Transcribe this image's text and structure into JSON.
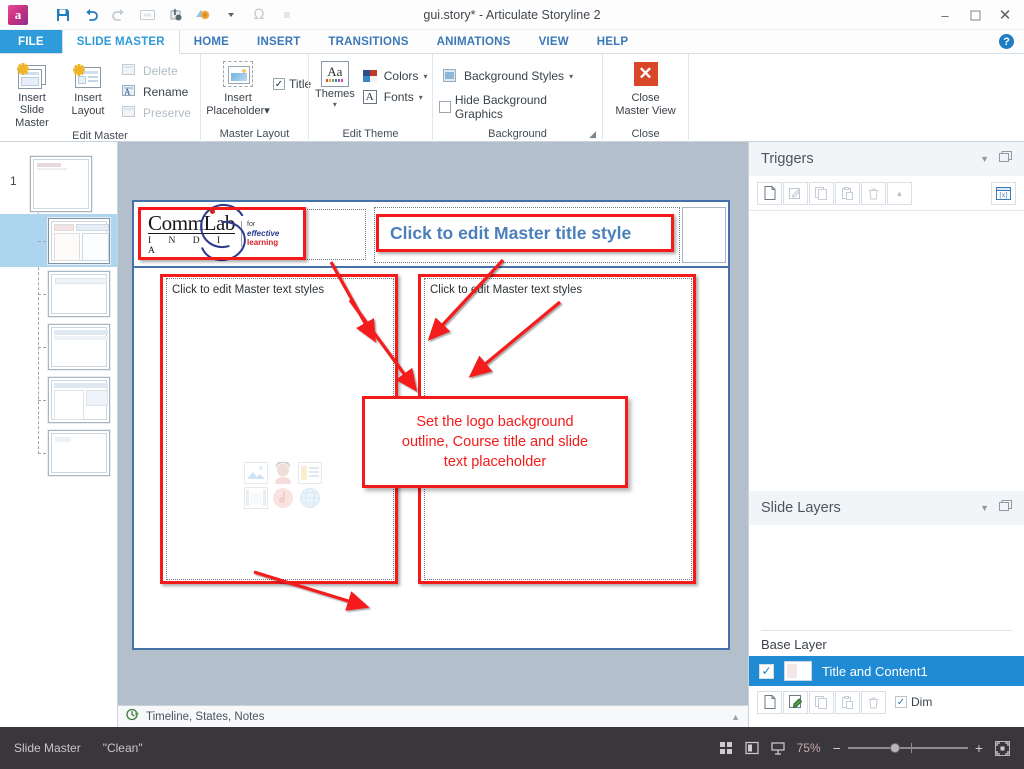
{
  "titlebar": {
    "app_icon": "articulate-logo-icon",
    "document_title": "gui.story*  -  Articulate Storyline 2",
    "quick_access": [
      {
        "name": "save-icon",
        "label": "Save",
        "state": "enabled"
      },
      {
        "name": "undo-icon",
        "label": "Undo",
        "state": "enabled"
      },
      {
        "name": "redo-icon",
        "label": "Redo",
        "state": "disabled"
      },
      {
        "name": "preview-icon",
        "label": "Preview",
        "state": "disabled"
      },
      {
        "name": "publish-icon",
        "label": "Publish",
        "state": "enabled"
      },
      {
        "name": "translation-icon",
        "label": "Translation",
        "state": "enabled"
      },
      {
        "name": "symbol-omega-icon",
        "label": "Symbol",
        "state": "disabled"
      },
      {
        "name": "customize-qat-icon",
        "label": "Customize Quick Access Toolbar",
        "state": "enabled"
      }
    ],
    "window_controls": [
      {
        "name": "minimize-button",
        "glyph": "–"
      },
      {
        "name": "maximize-button",
        "glyph": "❐"
      },
      {
        "name": "close-button",
        "glyph": "✕"
      }
    ]
  },
  "ribbon": {
    "tabs": [
      {
        "label": "FILE",
        "key": "file"
      },
      {
        "label": "SLIDE MASTER",
        "key": "slide-master",
        "active": true
      },
      {
        "label": "HOME",
        "key": "home"
      },
      {
        "label": "INSERT",
        "key": "insert"
      },
      {
        "label": "TRANSITIONS",
        "key": "transitions"
      },
      {
        "label": "ANIMATIONS",
        "key": "animations"
      },
      {
        "label": "VIEW",
        "key": "view"
      },
      {
        "label": "HELP",
        "key": "help"
      }
    ],
    "help_icon": "?",
    "groups": {
      "edit_master": {
        "label": "Edit Master",
        "insert_slide_master": "Insert Slide\nMaster",
        "insert_slide_master_l1": "Insert Slide",
        "insert_slide_master_l2": "Master",
        "insert_layout_l1": "Insert",
        "insert_layout_l2": "Layout",
        "delete": "Delete",
        "rename": "Rename",
        "preserve": "Preserve"
      },
      "master_layout": {
        "label": "Master Layout",
        "insert_placeholder_l1": "Insert",
        "insert_placeholder_l2": "Placeholder",
        "title_checkbox": "Title",
        "title_checked": true
      },
      "edit_theme": {
        "label": "Edit Theme",
        "themes": "Themes",
        "colors": "Colors",
        "fonts": "Fonts"
      },
      "background": {
        "label": "Background",
        "background_styles": "Background Styles",
        "hide_background_graphics": "Hide Background Graphics",
        "hide_background_graphics_checked": false
      },
      "close": {
        "label": "Close",
        "close_master_view_l1": "Close",
        "close_master_view_l2": "Master View"
      }
    }
  },
  "thumbnails": {
    "slide_number": "1",
    "items": [
      {
        "name": "thumb-master",
        "selected": false
      },
      {
        "name": "thumb-title-and-content1",
        "selected": true
      },
      {
        "name": "thumb-layout-3",
        "selected": false
      },
      {
        "name": "thumb-layout-4",
        "selected": false
      },
      {
        "name": "thumb-layout-5",
        "selected": false
      },
      {
        "name": "thumb-layout-6",
        "selected": false
      }
    ]
  },
  "slide": {
    "logo": {
      "word_top": "CommLab",
      "word_bottom": "I N D I A",
      "tag_line1": "for",
      "tag_line2_italic": "effective",
      "tag_line2_bold": " learning"
    },
    "title_placeholder": "Click to edit Master title style",
    "body_placeholder_left": "Click to edit Master text styles",
    "body_placeholder_right": "Click to edit Master text styles",
    "callout": {
      "line1": "Set the logo background",
      "line2": "outline, Course title and slide",
      "line3": "text placeholder"
    },
    "content_icons": [
      "picture-icon",
      "character-icon",
      "table-icon",
      "video-icon",
      "audio-icon",
      "web-object-icon"
    ]
  },
  "timeline_strip": {
    "icon": "timeline-icon",
    "label": "Timeline, States, Notes",
    "expand_icon": "chevron-up-icon"
  },
  "triggers_panel": {
    "title": "Triggers",
    "collapse_icon": "chevron-down-icon",
    "undock_icon": "undock-icon",
    "toolbar": [
      {
        "name": "new-trigger-button",
        "icon": "new-document-icon",
        "state": "enabled"
      },
      {
        "name": "edit-trigger-button",
        "icon": "edit-pencil-icon",
        "state": "disabled"
      },
      {
        "name": "copy-trigger-button",
        "icon": "copy-icon",
        "state": "disabled"
      },
      {
        "name": "paste-trigger-button",
        "icon": "paste-icon",
        "state": "disabled"
      },
      {
        "name": "delete-trigger-button",
        "icon": "trash-icon",
        "state": "disabled"
      },
      {
        "name": "move-up-trigger-button",
        "icon": "chevron-up-icon",
        "state": "disabled"
      },
      {
        "name": "manage-variables-button",
        "icon": "variable-icon",
        "state": "enabled"
      }
    ]
  },
  "slide_layers_panel": {
    "title": "Slide Layers",
    "collapse_icon": "chevron-down-icon",
    "undock_icon": "undock-icon",
    "base_layer_label": "Base Layer",
    "layer": {
      "name": "Title and Content1",
      "visible": true,
      "selected": true
    },
    "toolbar": [
      {
        "name": "new-layer-button",
        "icon": "new-document-icon",
        "state": "enabled"
      },
      {
        "name": "layer-properties-button",
        "icon": "properties-icon",
        "state": "enabled"
      },
      {
        "name": "copy-layer-button",
        "icon": "copy-icon",
        "state": "disabled"
      },
      {
        "name": "paste-layer-button",
        "icon": "paste-icon",
        "state": "disabled"
      },
      {
        "name": "delete-layer-button",
        "icon": "trash-icon",
        "state": "disabled"
      }
    ],
    "dim_label": "Dim",
    "dim_checked": true
  },
  "statusbar": {
    "mode": "Slide Master",
    "theme_name": "\"Clean\"",
    "view_icons": [
      {
        "name": "story-view-icon"
      },
      {
        "name": "slide-view-icon"
      },
      {
        "name": "presenter-view-icon"
      }
    ],
    "zoom_level": "75%",
    "zoom_out": "−",
    "zoom_in": "+",
    "fit_icon": "fit-to-window-icon"
  },
  "colors": {
    "accent_blue": "#2e9bda",
    "tab_text_blue": "#3b78b8",
    "annotation_red": "#f41a1a",
    "title_placeholder_blue": "#4a7fba",
    "selection_blue": "#1e8bd4",
    "thumb_selection": "#aed5ef",
    "statusbar_bg": "#39363c",
    "canvas_bg": "#b3bfca",
    "slide_border": "#4472a8"
  }
}
